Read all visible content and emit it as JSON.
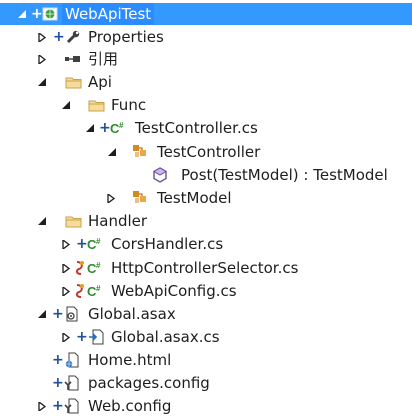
{
  "tree": {
    "root": {
      "label": "WebApiTest",
      "icon": "web-project-icon"
    },
    "properties": {
      "label": "Properties",
      "icon": "wrench-icon"
    },
    "references": {
      "label": "引用",
      "icon": "references-icon"
    },
    "api": {
      "label": "Api",
      "icon": "folder-icon"
    },
    "func": {
      "label": "Func",
      "icon": "folder-icon"
    },
    "test_controller_cs": {
      "label": "TestController.cs",
      "icon": "csharp-file-icon"
    },
    "test_controller_class": {
      "label": "TestController",
      "icon": "class-icon"
    },
    "post_method": {
      "label": "Post(TestModel) : TestModel",
      "icon": "method-icon"
    },
    "test_model_class": {
      "label": "TestModel",
      "icon": "class-icon"
    },
    "handler": {
      "label": "Handler",
      "icon": "folder-icon"
    },
    "cors_handler": {
      "label": "CorsHandler.cs",
      "icon": "csharp-file-icon"
    },
    "http_controller_selector": {
      "label": "HttpControllerSelector.cs",
      "icon": "csharp-file-icon"
    },
    "web_api_config": {
      "label": "WebApiConfig.cs",
      "icon": "csharp-file-icon"
    },
    "global_asax": {
      "label": "Global.asax",
      "icon": "asax-file-icon"
    },
    "global_asax_cs": {
      "label": "Global.asax.cs",
      "icon": "csharp-file-icon"
    },
    "home_html": {
      "label": "Home.html",
      "icon": "html-file-icon"
    },
    "packages_config": {
      "label": "packages.config",
      "icon": "config-file-icon"
    },
    "web_config": {
      "label": "Web.config",
      "icon": "config-file-icon"
    }
  },
  "colors": {
    "selection": "#3399ff",
    "plus_marker": "#1f4f9a",
    "csharp_green": "#2e8b2e",
    "folder": "#e7c36b",
    "class_orange": "#d68a1e",
    "method_purple": "#6b4fa0"
  }
}
